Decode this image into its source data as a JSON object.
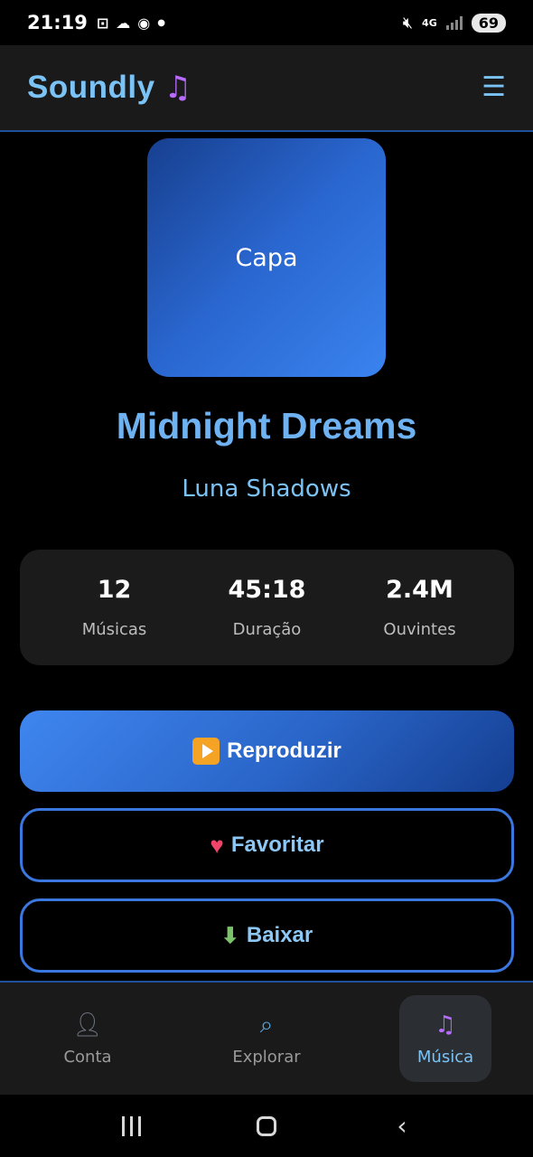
{
  "status_bar": {
    "time": "21:19",
    "network": "4G",
    "battery": "69",
    "icons_left": [
      "screenshot-icon",
      "cloud-icon",
      "eye-icon",
      "dot-icon"
    ],
    "icons_right": [
      "mute-icon",
      "network-icon",
      "signal-icon",
      "battery-icon"
    ]
  },
  "header": {
    "brand": "Soundly",
    "brand_icon": "music-note-icon",
    "menu_icon": "hamburger-menu-icon"
  },
  "album": {
    "cover_label": "Capa",
    "title": "Midnight Dreams",
    "artist": "Luna Shadows"
  },
  "stats": [
    {
      "value": "12",
      "label": "Músicas"
    },
    {
      "value": "45:18",
      "label": "Duração"
    },
    {
      "value": "2.4M",
      "label": "Ouvintes"
    }
  ],
  "actions": {
    "play_label": "Reproduzir",
    "favorite_label": "Favoritar",
    "download_label": "Baixar"
  },
  "bottom_nav": [
    {
      "label": "Conta",
      "icon": "user-icon",
      "active": false
    },
    {
      "label": "Explorar",
      "icon": "search-icon",
      "active": false
    },
    {
      "label": "Música",
      "icon": "music-note-icon",
      "active": true
    }
  ],
  "colors": {
    "accent": "#7cc3f5",
    "title": "#6fb2f2",
    "primary_button": "#2a65c8",
    "outline": "#3a78df",
    "header_bg": "#1a1a1a"
  }
}
